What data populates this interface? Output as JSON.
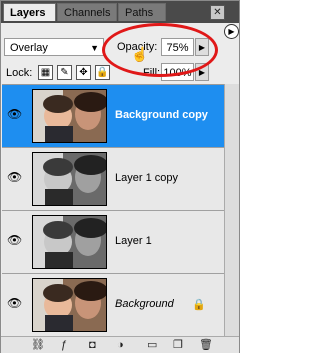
{
  "tabs": [
    {
      "label": "Layers"
    },
    {
      "label": "Channels"
    },
    {
      "label": "Paths"
    }
  ],
  "blend_mode": {
    "value": "Overlay"
  },
  "opacity": {
    "label": "Opacity:",
    "value": "75%"
  },
  "lock": {
    "label": "Lock:"
  },
  "fill": {
    "label": "Fill:",
    "value": "100%"
  },
  "highlight_color": "#e01818",
  "selected_color": "#1e8ef0",
  "layers": [
    {
      "name": "Background copy",
      "thumbnail": "color"
    },
    {
      "name": "Layer 1 copy",
      "thumbnail": "grayscale"
    },
    {
      "name": "Layer 1",
      "thumbnail": "grayscale"
    },
    {
      "name": "Background",
      "thumbnail": "color"
    }
  ]
}
